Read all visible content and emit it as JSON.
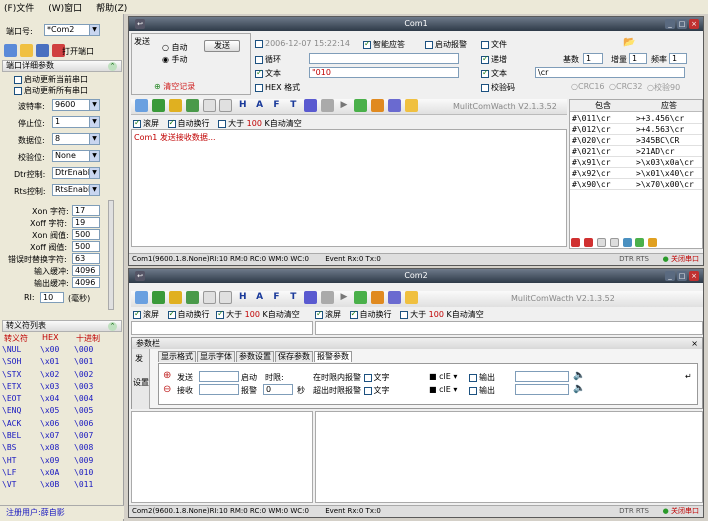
{
  "menu": {
    "file": "(F)文件",
    "window": "(W)窗口",
    "help": "帮助(Z)"
  },
  "left": {
    "port_label": "端口号:",
    "port_value": "*Com2",
    "open_port": "打开端口",
    "params_header": "端口详细参数",
    "opt_top": "启动更新当前串口",
    "opt_all": "启动更新所有串口",
    "baud_label": "波特率:",
    "baud": "9600",
    "stop_label": "停止位:",
    "stop": "1",
    "data_label": "数据位:",
    "databits": "8",
    "parity_label": "校验位:",
    "parity": "None",
    "dtr_label": "Dtr控制:",
    "dtr": "DtrEnable",
    "rts_label": "Rts控制:",
    "rts": "RtsEnable",
    "xon_char_label": "Xon 字符:",
    "xon_char": "17",
    "xoff_char_label": "Xoff 字符:",
    "xoff_char": "19",
    "xon_thr_label": "Xon 阀值:",
    "xon_thr": "500",
    "xoff_thr_label": "Xoff 阀值:",
    "xoff_thr": "500",
    "err_label": "错误时替换字符:",
    "err": "63",
    "inbuf_label": "输入缓冲:",
    "inbuf": "4096",
    "outbuf_label": "输出缓冲:",
    "outbuf": "4096",
    "ri_label": "RI:",
    "ri": "10",
    "ri_unit": "(毫秒)",
    "esc_header": "转义符列表",
    "esc_cols": [
      "转义符",
      "HEX",
      "十进制"
    ],
    "esc_rows": [
      [
        "\\NUL",
        "\\x00",
        "\\000"
      ],
      [
        "\\SOH",
        "\\x01",
        "\\001"
      ],
      [
        "\\STX",
        "\\x02",
        "\\002"
      ],
      [
        "\\ETX",
        "\\x03",
        "\\003"
      ],
      [
        "\\EOT",
        "\\x04",
        "\\004"
      ],
      [
        "\\ENQ",
        "\\x05",
        "\\005"
      ],
      [
        "\\ACK",
        "\\x06",
        "\\006"
      ],
      [
        "\\BEL",
        "\\x07",
        "\\007"
      ],
      [
        "\\BS",
        "\\x08",
        "\\008"
      ],
      [
        "\\HT",
        "\\x09",
        "\\009"
      ],
      [
        "\\LF",
        "\\x0A",
        "\\010"
      ],
      [
        "\\VT",
        "\\x0B",
        "\\011"
      ]
    ],
    "user": "注册用户:薛自影"
  },
  "com1": {
    "title": "Com1",
    "send_group": "发送",
    "auto": "自动",
    "manual": "手动",
    "send_btn": "发送",
    "time": "2006-12-07 15:22:14",
    "smart": "智能应答",
    "start_alarm": "启动报警",
    "loop": "循环",
    "text_lbl": "文本",
    "text_val": "\"010",
    "hex_lbl": "HEX 格式",
    "clear": "清空记录",
    "file": "文件",
    "incr": "递增",
    "base_lbl": "基数",
    "base": "1",
    "step_lbl": "增量",
    "step": "1",
    "freq_lbl": "频率",
    "freq": "1",
    "text2_lbl": "文本",
    "text2_val": "\\cr",
    "checksum": "校验码",
    "crc16": "CRC16",
    "crc32": "CRC32",
    "chk90": "校验90",
    "brand": "MulitComWacth V2.1.3.52",
    "scroll": "滚屏",
    "autowrap": "自动换行",
    "gt": "大于",
    "gt_val": "100",
    "kclear": "K自动清空",
    "log": "Com1 发送接收数据...",
    "pkg_header": "包含",
    "resp_header": "应答",
    "pkg_rows": [
      [
        "#\\011\\cr",
        ">+3.456\\cr"
      ],
      [
        "#\\012\\cr",
        ">+4.563\\cr"
      ],
      [
        "#\\020\\cr",
        ">345BC\\CR"
      ],
      [
        "#\\021\\cr",
        ">21AD\\cr"
      ],
      [
        "#\\x91\\cr",
        ">\\x03\\x0a\\cr"
      ],
      [
        "#\\x92\\cr",
        ">\\x01\\x40\\cr"
      ],
      [
        "#\\x90\\cr",
        ">\\x70\\x00\\cr"
      ]
    ],
    "status": "Com1(9600.1.8.None)RI:10 RM:0 RC:0 WM:0 WC:0",
    "status_mid": "Event Rx:0 Tx:0",
    "close_port": "关闭串口"
  },
  "com2": {
    "title": "Com2",
    "brand": "MulitComWacth V2.1.3.52",
    "scroll": "滚屏",
    "autowrap": "自动换行",
    "gt": "大于",
    "gt_val": "100",
    "kclear": "K自动清空",
    "scroll2": "滚屏",
    "autowrap2": "自动换行",
    "gt2": "大于",
    "gt_val2": "100",
    "kclear2": "K自动清空",
    "param_bar": "参数栏",
    "tabs": [
      "显示格式",
      "显示字体",
      "参数设置",
      "保存参数",
      "报警参数"
    ],
    "send": "发",
    "setup": "设置",
    "send_lbl": "发送",
    "recv_lbl": "接收",
    "start_lbl": "启动",
    "alarm_lbl": "报警",
    "time_lbl": "时限:",
    "time_val": "0",
    "sec": "秒",
    "in_limit": "在时限内报警",
    "out_limit": "超出时限报警",
    "text_a": "文字",
    "text_b": "文字",
    "cle": "clE",
    "output": "输出",
    "output2": "输出",
    "status": "Com2(9600.1.8.None)RI:10 RM:0 RC:0 WM:0 WC:0",
    "status_mid": "Event Rx:0 Tx:0",
    "close_port": "关闭串口"
  }
}
